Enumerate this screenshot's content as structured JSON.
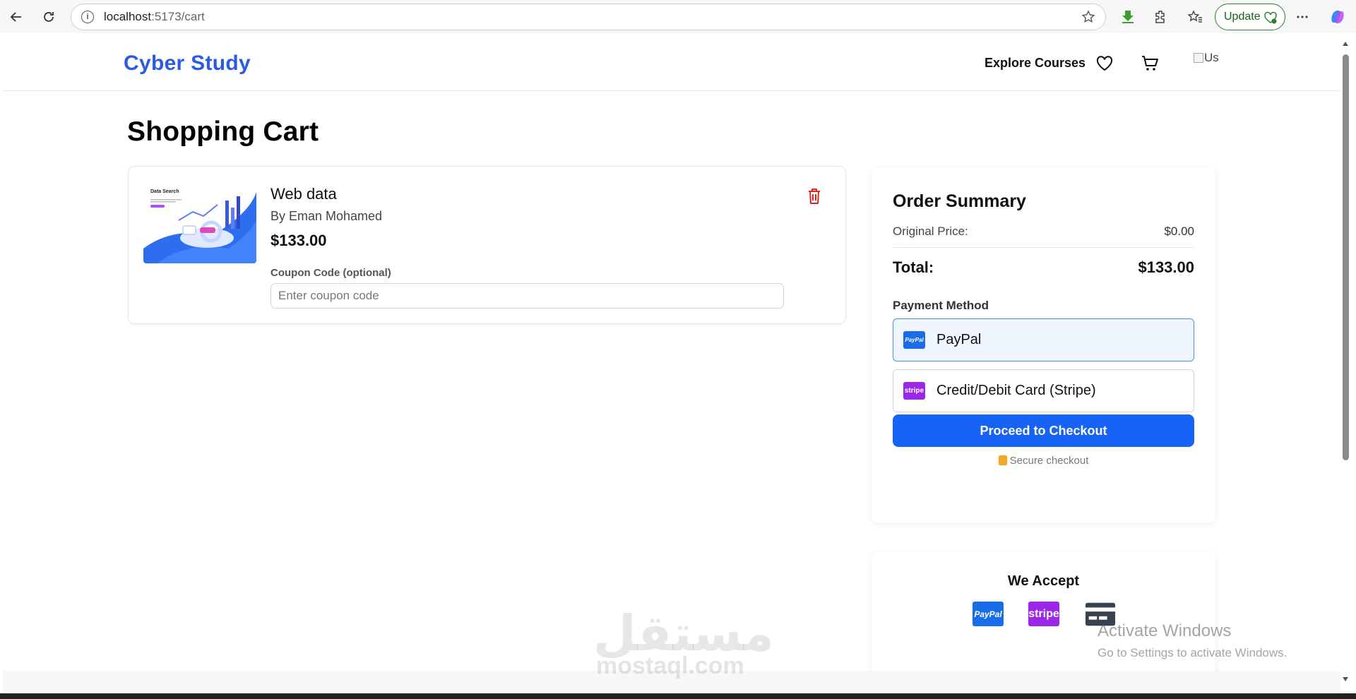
{
  "browser": {
    "url_host": "localhost",
    "url_path": ":5173/cart",
    "update_label": "Update"
  },
  "header": {
    "logo": "Cyber Study",
    "explore": "Explore Courses",
    "avatar_alt": "Us"
  },
  "page": {
    "title": "Shopping Cart"
  },
  "cart_item": {
    "thumbnail_text": "Data Search",
    "title": "Web data",
    "author": "By Eman Mohamed",
    "price": "$133.00",
    "coupon_label": "Coupon Code (optional)",
    "coupon_placeholder": "Enter coupon code",
    "coupon_value": ""
  },
  "summary": {
    "title": "Order Summary",
    "original_label": "Original Price:",
    "original_value": "$0.00",
    "total_label": "Total:",
    "total_value": "$133.00",
    "payment_label": "Payment Method",
    "options": [
      {
        "label": "PayPal",
        "badge": "PayPal",
        "selected": true
      },
      {
        "label": "Credit/Debit Card (Stripe)",
        "badge": "stripe",
        "selected": false
      }
    ],
    "checkout_button": "Proceed to Checkout",
    "secure_note": "Secure checkout"
  },
  "accept": {
    "title": "We Accept",
    "badges": [
      "PayPal",
      "stripe"
    ]
  },
  "watermark": {
    "arabic": "مستقل",
    "latin": "mostaql.com"
  },
  "os_notice": {
    "title": "Activate Windows",
    "subtitle": "Go to Settings to activate Windows."
  },
  "colors": {
    "brand": "#2b5be0",
    "primary_button": "#1763f5",
    "paypal": "#1a6ce8",
    "stripe": "#9b28e8",
    "danger": "#dc2626"
  }
}
